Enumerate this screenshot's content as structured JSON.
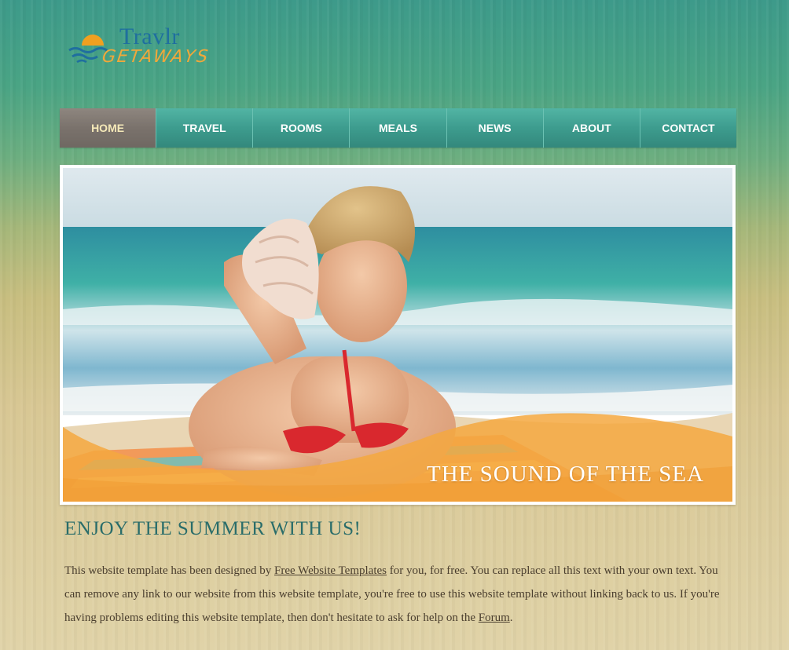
{
  "logo": {
    "name_top": "Travlr",
    "name_bottom": "GETAWAYS"
  },
  "nav": {
    "items": [
      {
        "label": "HOME",
        "active": true
      },
      {
        "label": "TRAVEL"
      },
      {
        "label": "ROOMS"
      },
      {
        "label": "MEALS"
      },
      {
        "label": "NEWS"
      },
      {
        "label": "ABOUT"
      },
      {
        "label": "CONTACT"
      }
    ]
  },
  "hero": {
    "caption": "THE SOUND OF THE SEA"
  },
  "content": {
    "heading": "ENJOY THE SUMMER WITH US!",
    "p_part1": "This website template has been designed by ",
    "link1": "Free Website Templates",
    "p_part2": " for you, for free. You can replace all this text with your own text. You can remove any link to our website from this website template, you're free to use this website template without linking back to us. If you're having problems editing this website template, then don't hesitate to ask for help on the ",
    "link2": "Forum",
    "p_part3": "."
  },
  "colors": {
    "nav_teal": "#3d9c8e",
    "nav_active": "#7a726c",
    "heading": "#2a6d6a",
    "caption_band": "#f5a840"
  }
}
